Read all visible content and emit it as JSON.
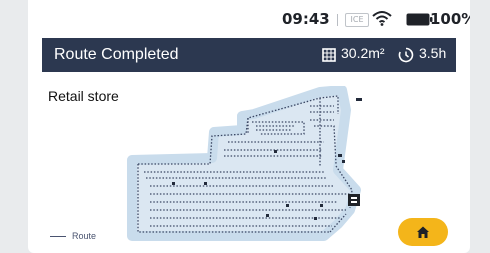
{
  "status": {
    "time": "09:43",
    "ice": "ICE",
    "battery": "100%"
  },
  "header": {
    "title": "Route Completed",
    "area": "30.2m²",
    "duration": "3.5h"
  },
  "map": {
    "name": "Retail store"
  },
  "legend": {
    "route_label": "Route"
  },
  "colors": {
    "header_bg": "#2c3850",
    "accent": "#f4b51a",
    "route": "#3a4663"
  },
  "icons": {
    "area": "area-icon",
    "clock": "clock-icon",
    "home": "home-icon",
    "robot": "robot-dock-icon"
  }
}
